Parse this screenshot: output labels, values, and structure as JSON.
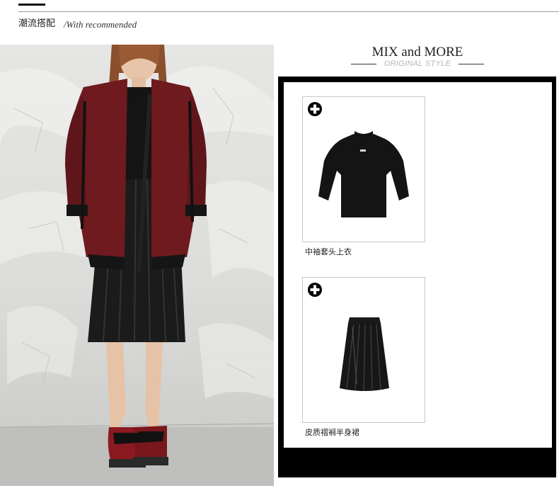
{
  "header": {
    "title": "潮流搭配",
    "subtitle": "/With recommended"
  },
  "section": {
    "title": "MIX and MORE",
    "subtitle": "ORIGINAL STYLE"
  },
  "products": [
    {
      "name": "中袖套头上衣",
      "icon": "plus-circle-icon"
    },
    {
      "name": "皮质褶裥半身裙",
      "icon": "plus-circle-icon"
    }
  ],
  "colors": {
    "frame": "#000000",
    "jacket": "#6e1a1f",
    "header_rule": "#9a9a9a",
    "subtitle_gray": "#b5b5b5"
  }
}
